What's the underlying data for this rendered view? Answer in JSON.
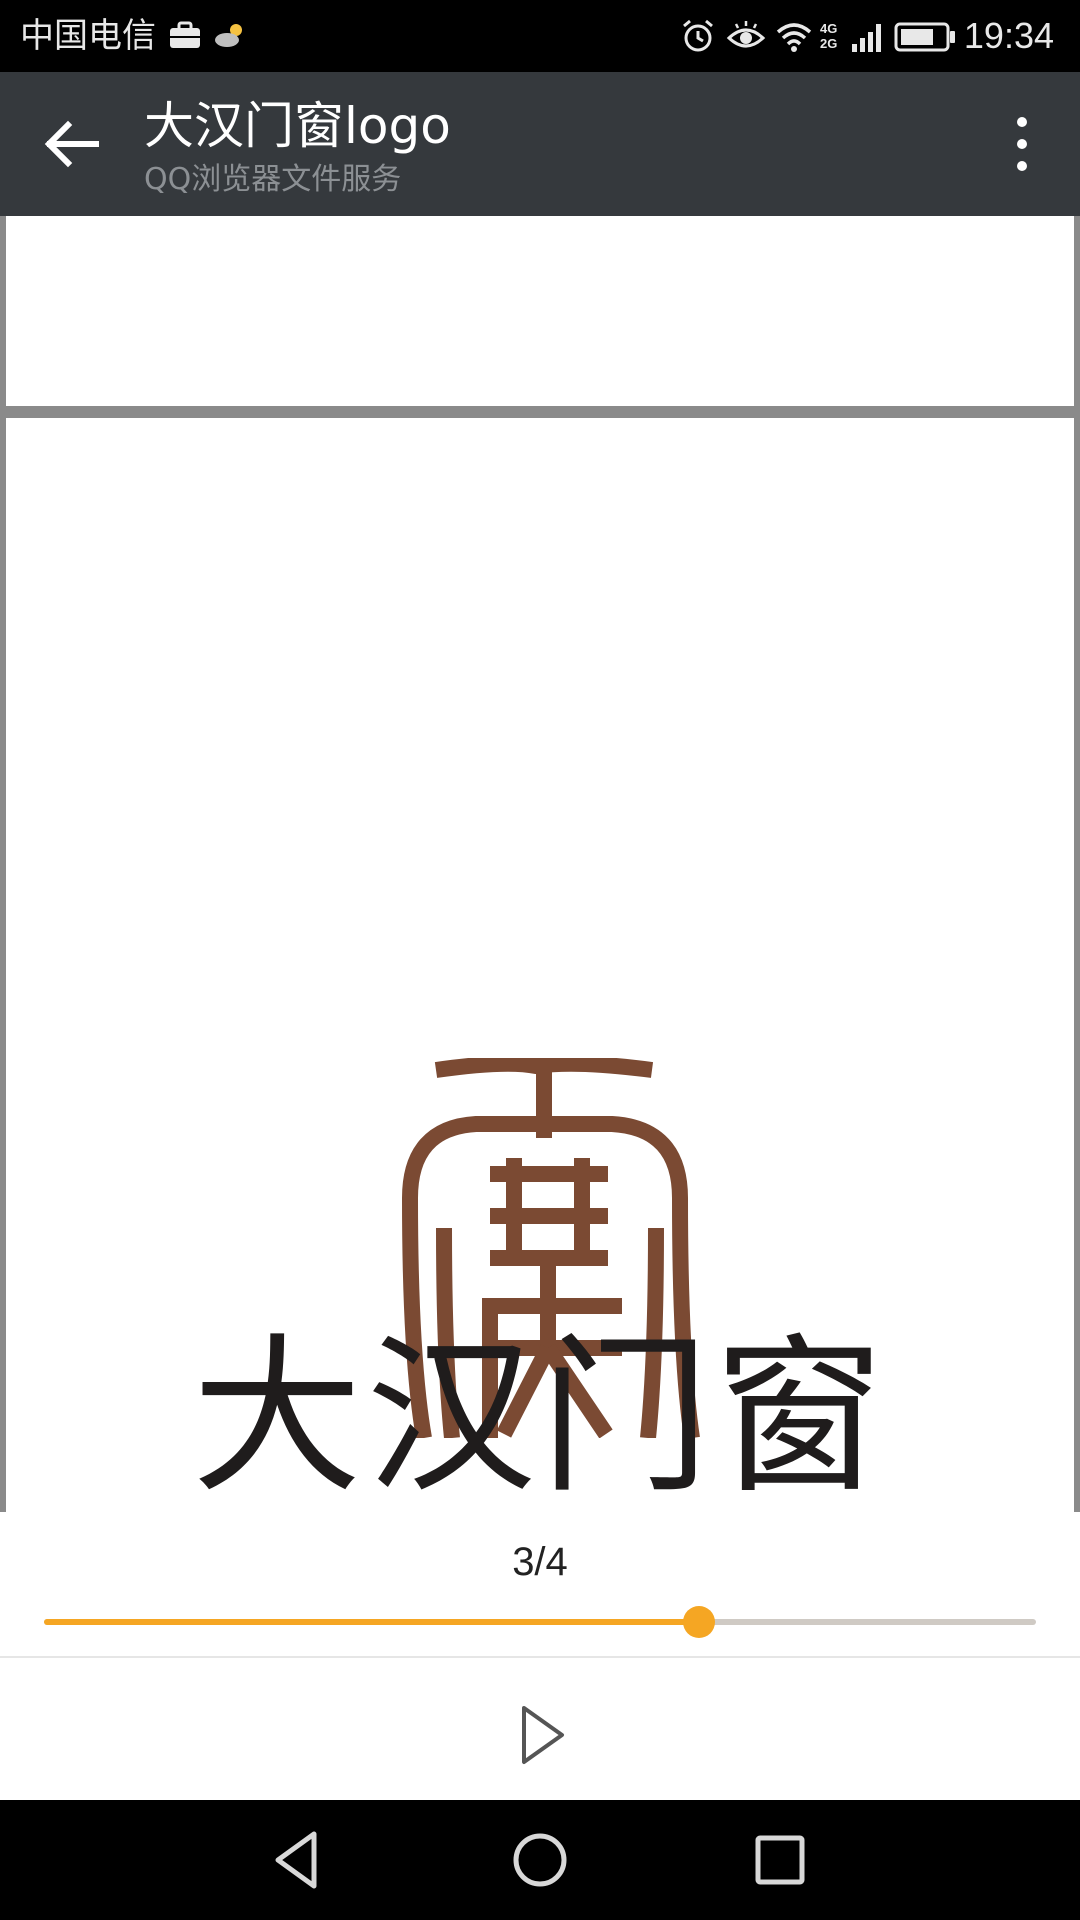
{
  "status_bar": {
    "carrier": "中国电信",
    "network": "4G 2G",
    "time": "19:34",
    "icons": [
      "briefcase-icon",
      "weather-cloud-icon",
      "alarm-icon",
      "eye-comfort-icon",
      "wifi-icon",
      "signal-icon",
      "battery-icon"
    ]
  },
  "app_bar": {
    "title": "大汉门窗logo",
    "subtitle": "QQ浏览器文件服务",
    "back_icon": "arrow-left-icon",
    "menu_icon": "more-vertical-icon"
  },
  "document": {
    "logo_wordmark": "大汉门窗",
    "logo_color": "#7b4a33",
    "wordmark_color": "#1f1c1c"
  },
  "pager": {
    "indicator": "3/4",
    "current_page": 3,
    "total_pages": 4,
    "progress_fraction": 0.66,
    "accent": "#f5a623",
    "play_icon": "play-icon"
  },
  "nav_bar": {
    "icons": [
      "nav-back-icon",
      "nav-home-icon",
      "nav-recents-icon"
    ]
  }
}
